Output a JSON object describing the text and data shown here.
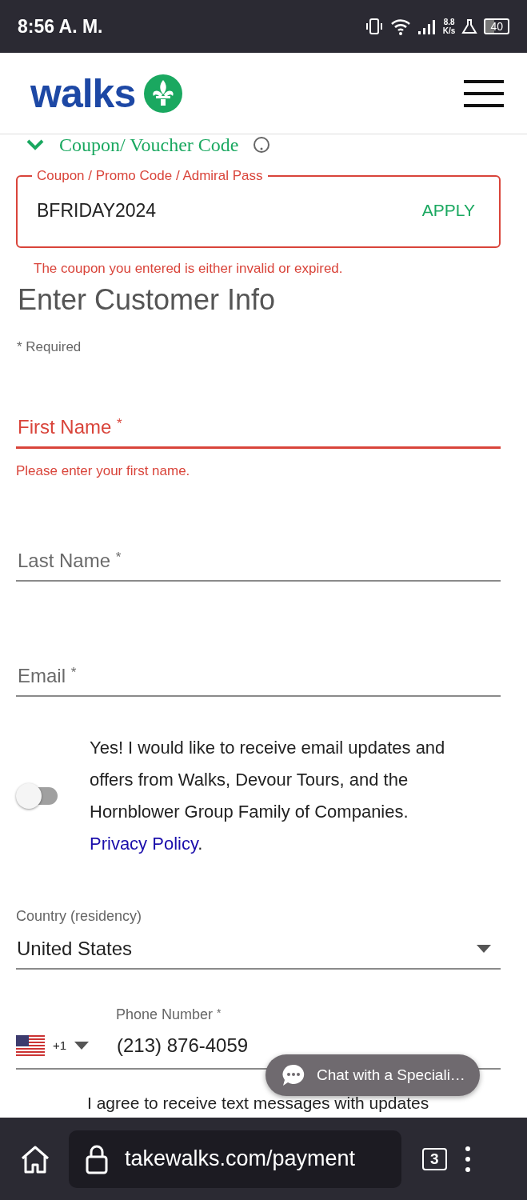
{
  "status_bar": {
    "time": "8:56 A. M.",
    "speed": "8.8",
    "speed_unit": "K/s",
    "battery": "40"
  },
  "header": {
    "logo": "walks"
  },
  "coupon": {
    "section_title": "Coupon/ Voucher Code",
    "expanded": true,
    "label": "Coupon / Promo Code / Admiral Pass",
    "value": "BFRIDAY2024",
    "button": "APPLY",
    "error": "The coupon you entered is either invalid or expired."
  },
  "customer": {
    "heading": "Enter Customer Info",
    "required_note": "* Required",
    "fields": [
      {
        "label": "First Name",
        "required_mark": "*",
        "invalid": true,
        "error": "Please enter your first name."
      },
      {
        "label": "Last Name",
        "required_mark": "*",
        "invalid": false
      },
      {
        "label": "Email",
        "required_mark": "*",
        "invalid": false
      }
    ]
  },
  "newsletter": {
    "on": false,
    "text": "Yes! I would like to receive email updates and offers from Walks, Devour Tours, and the Hornblower Group Family of Companies.",
    "link": "Privacy Policy",
    "after": "."
  },
  "country": {
    "label": "Country (residency)",
    "value": "United States"
  },
  "phone": {
    "label": "Phone Number",
    "required_mark": "*",
    "dial_code": "+1",
    "value": "(213) 876-4059"
  },
  "sms_text": "I agree to receive text messages with updates",
  "chat_button": "Chat with a Speciali…",
  "browser": {
    "url": "takewalks.com/payment",
    "tab_count": "3"
  }
}
